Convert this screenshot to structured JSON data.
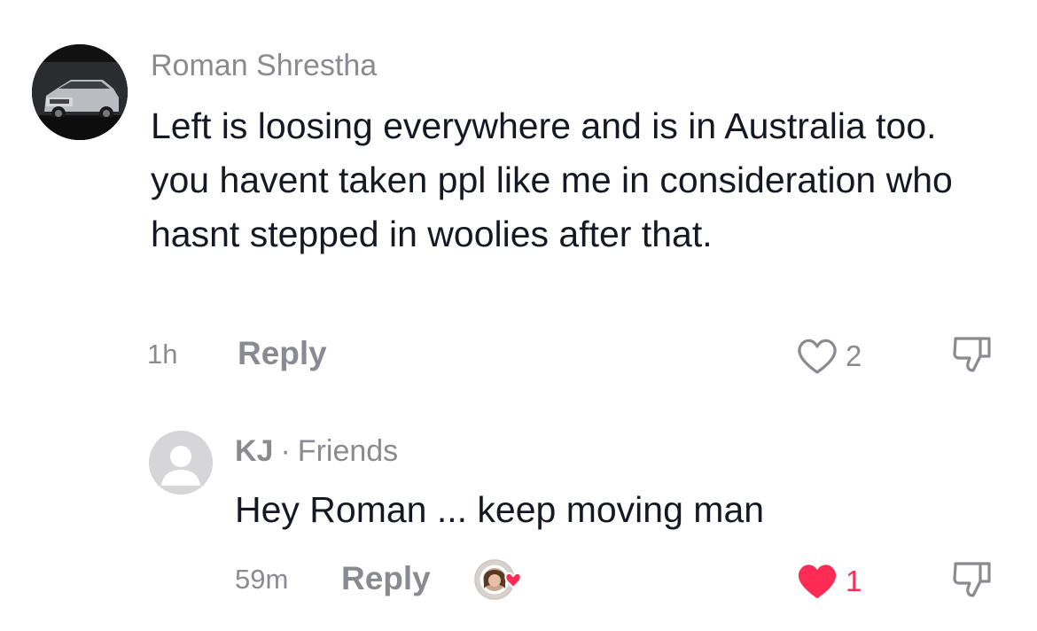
{
  "comments": [
    {
      "username": "Roman Shrestha",
      "avatar_icon": "car-avatar",
      "text": "Left is loosing everywhere and is in Australia too. you havent taken ppl like me in consideration who hasnt stepped in woolies after that.",
      "time": "1h",
      "reply_label": "Reply",
      "like_count": "2",
      "liked": false,
      "like_icon": "heart-outline-icon",
      "dislike_icon": "thumbs-down-icon"
    }
  ],
  "reply": {
    "username": "KJ",
    "separator": "·",
    "relationship": "Friends",
    "avatar_icon": "default-user-avatar",
    "text": "Hey Roman ... keep moving man",
    "time": "59m",
    "reply_label": "Reply",
    "like_count": "1",
    "liked": true,
    "like_icon": "heart-filled-icon",
    "creator_liked_icon": "creator-liked-badge",
    "dislike_icon": "thumbs-down-icon"
  },
  "colors": {
    "text": "#161823",
    "muted": "#8a8b91",
    "like_active": "#fe2c55"
  }
}
